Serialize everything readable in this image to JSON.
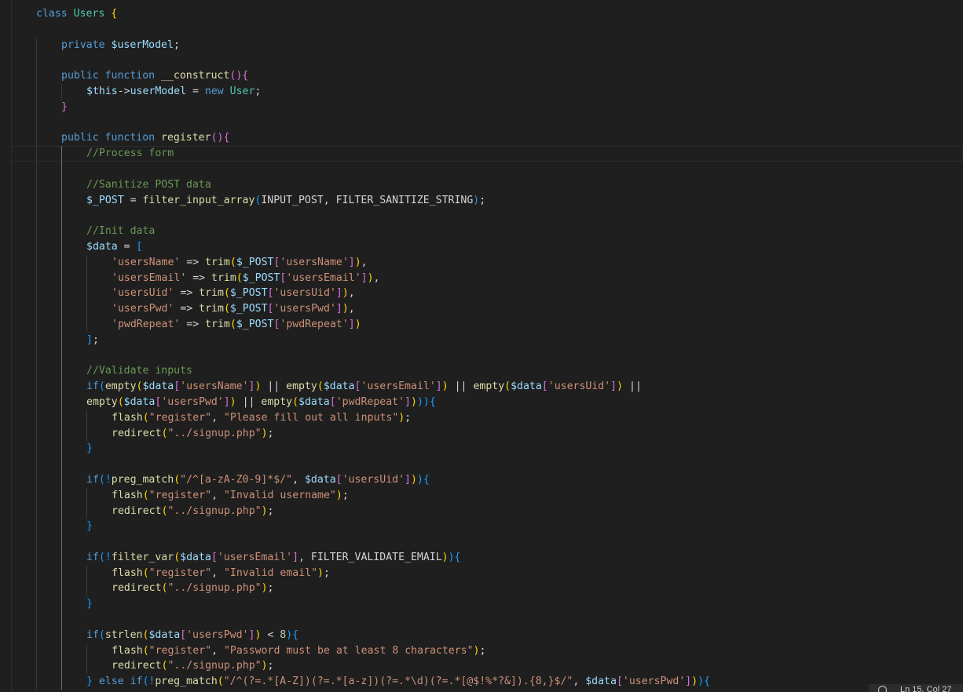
{
  "editor": {
    "language": "php",
    "lines": [
      [
        [
          "kw",
          "class "
        ],
        [
          "cls",
          "Users "
        ],
        [
          "b1",
          "{"
        ]
      ],
      [],
      [
        [
          "kw",
          "private "
        ],
        [
          "var",
          "$userModel"
        ],
        [
          "op",
          ";"
        ]
      ],
      [],
      [
        [
          "kw",
          "public "
        ],
        [
          "kw",
          "function "
        ],
        [
          "fn",
          "__construct"
        ],
        [
          "b2",
          "(){"
        ]
      ],
      [
        [
          "var",
          "$this"
        ],
        [
          "op",
          "->"
        ],
        [
          "var",
          "userModel"
        ],
        [
          "op",
          " = "
        ],
        [
          "kw",
          "new "
        ],
        [
          "cls",
          "User"
        ],
        [
          "op",
          ";"
        ]
      ],
      [
        [
          "b2",
          "}"
        ]
      ],
      [],
      [
        [
          "kw",
          "public "
        ],
        [
          "kw",
          "function "
        ],
        [
          "fn",
          "register"
        ],
        [
          "b2",
          "(){"
        ]
      ],
      [
        [
          "cmt",
          "//Process form"
        ]
      ],
      [],
      [
        [
          "cmt",
          "//Sanitize POST data"
        ]
      ],
      [
        [
          "var",
          "$_POST"
        ],
        [
          "op",
          " = "
        ],
        [
          "fn",
          "filter_input_array"
        ],
        [
          "b3",
          "("
        ],
        [
          "const",
          "INPUT_POST, FILTER_SANITIZE_STRING"
        ],
        [
          "b3",
          ")"
        ],
        [
          "op",
          ";"
        ]
      ],
      [],
      [
        [
          "cmt",
          "//Init data"
        ]
      ],
      [
        [
          "var",
          "$data"
        ],
        [
          "op",
          " = "
        ],
        [
          "b3",
          "["
        ]
      ],
      [
        [
          "str",
          "'usersName'"
        ],
        [
          "op",
          " => "
        ],
        [
          "fn",
          "trim"
        ],
        [
          "b1",
          "("
        ],
        [
          "var",
          "$_POST"
        ],
        [
          "b2",
          "["
        ],
        [
          "str",
          "'usersName'"
        ],
        [
          "b2",
          "]"
        ],
        [
          "b1",
          ")"
        ],
        [
          "op",
          ","
        ]
      ],
      [
        [
          "str",
          "'usersEmail'"
        ],
        [
          "op",
          " => "
        ],
        [
          "fn",
          "trim"
        ],
        [
          "b1",
          "("
        ],
        [
          "var",
          "$_POST"
        ],
        [
          "b2",
          "["
        ],
        [
          "str",
          "'usersEmail'"
        ],
        [
          "b2",
          "]"
        ],
        [
          "b1",
          ")"
        ],
        [
          "op",
          ","
        ]
      ],
      [
        [
          "str",
          "'usersUid'"
        ],
        [
          "op",
          " => "
        ],
        [
          "fn",
          "trim"
        ],
        [
          "b1",
          "("
        ],
        [
          "var",
          "$_POST"
        ],
        [
          "b2",
          "["
        ],
        [
          "str",
          "'usersUid'"
        ],
        [
          "b2",
          "]"
        ],
        [
          "b1",
          ")"
        ],
        [
          "op",
          ","
        ]
      ],
      [
        [
          "str",
          "'usersPwd'"
        ],
        [
          "op",
          " => "
        ],
        [
          "fn",
          "trim"
        ],
        [
          "b1",
          "("
        ],
        [
          "var",
          "$_POST"
        ],
        [
          "b2",
          "["
        ],
        [
          "str",
          "'usersPwd'"
        ],
        [
          "b2",
          "]"
        ],
        [
          "b1",
          ")"
        ],
        [
          "op",
          ","
        ]
      ],
      [
        [
          "str",
          "'pwdRepeat'"
        ],
        [
          "op",
          " => "
        ],
        [
          "fn",
          "trim"
        ],
        [
          "b1",
          "("
        ],
        [
          "var",
          "$_POST"
        ],
        [
          "b2",
          "["
        ],
        [
          "str",
          "'pwdRepeat'"
        ],
        [
          "b2",
          "]"
        ],
        [
          "b1",
          ")"
        ]
      ],
      [
        [
          "b3",
          "]"
        ],
        [
          "op",
          ";"
        ]
      ],
      [],
      [
        [
          "cmt",
          "//Validate inputs"
        ]
      ],
      [
        [
          "kw",
          "if"
        ],
        [
          "b3",
          "("
        ],
        [
          "fn",
          "empty"
        ],
        [
          "b1",
          "("
        ],
        [
          "var",
          "$data"
        ],
        [
          "b2",
          "["
        ],
        [
          "str",
          "'usersName'"
        ],
        [
          "b2",
          "]"
        ],
        [
          "b1",
          ")"
        ],
        [
          "op",
          " || "
        ],
        [
          "fn",
          "empty"
        ],
        [
          "b1",
          "("
        ],
        [
          "var",
          "$data"
        ],
        [
          "b2",
          "["
        ],
        [
          "str",
          "'usersEmail'"
        ],
        [
          "b2",
          "]"
        ],
        [
          "b1",
          ")"
        ],
        [
          "op",
          " || "
        ],
        [
          "fn",
          "empty"
        ],
        [
          "b1",
          "("
        ],
        [
          "var",
          "$data"
        ],
        [
          "b2",
          "["
        ],
        [
          "str",
          "'usersUid'"
        ],
        [
          "b2",
          "]"
        ],
        [
          "b1",
          ")"
        ],
        [
          "op",
          " ||"
        ]
      ],
      [
        [
          "fn",
          "empty"
        ],
        [
          "b1",
          "("
        ],
        [
          "var",
          "$data"
        ],
        [
          "b2",
          "["
        ],
        [
          "str",
          "'usersPwd'"
        ],
        [
          "b2",
          "]"
        ],
        [
          "b1",
          ")"
        ],
        [
          "op",
          " || "
        ],
        [
          "fn",
          "empty"
        ],
        [
          "b1",
          "("
        ],
        [
          "var",
          "$data"
        ],
        [
          "b2",
          "["
        ],
        [
          "str",
          "'pwdRepeat'"
        ],
        [
          "b2",
          "]"
        ],
        [
          "b1",
          ")"
        ],
        [
          "b3",
          ")){"
        ]
      ],
      [
        [
          "fn",
          "flash"
        ],
        [
          "b1",
          "("
        ],
        [
          "str",
          "\"register\""
        ],
        [
          "op",
          ", "
        ],
        [
          "str",
          "\"Please fill out all inputs\""
        ],
        [
          "b1",
          ")"
        ],
        [
          "op",
          ";"
        ]
      ],
      [
        [
          "fn",
          "redirect"
        ],
        [
          "b1",
          "("
        ],
        [
          "str",
          "\"../signup.php\""
        ],
        [
          "b1",
          ")"
        ],
        [
          "op",
          ";"
        ]
      ],
      [
        [
          "b3",
          "}"
        ]
      ],
      [],
      [
        [
          "kw",
          "if"
        ],
        [
          "b3",
          "(!"
        ],
        [
          "fn",
          "preg_match"
        ],
        [
          "b1",
          "("
        ],
        [
          "str",
          "\"/^[a-zA-Z0-9]*$/\""
        ],
        [
          "op",
          ", "
        ],
        [
          "var",
          "$data"
        ],
        [
          "b2",
          "["
        ],
        [
          "str",
          "'usersUid'"
        ],
        [
          "b2",
          "]"
        ],
        [
          "b1",
          ")"
        ],
        [
          "b3",
          "){"
        ]
      ],
      [
        [
          "fn",
          "flash"
        ],
        [
          "b1",
          "("
        ],
        [
          "str",
          "\"register\""
        ],
        [
          "op",
          ", "
        ],
        [
          "str",
          "\"Invalid username\""
        ],
        [
          "b1",
          ")"
        ],
        [
          "op",
          ";"
        ]
      ],
      [
        [
          "fn",
          "redirect"
        ],
        [
          "b1",
          "("
        ],
        [
          "str",
          "\"../signup.php\""
        ],
        [
          "b1",
          ")"
        ],
        [
          "op",
          ";"
        ]
      ],
      [
        [
          "b3",
          "}"
        ]
      ],
      [],
      [
        [
          "kw",
          "if"
        ],
        [
          "b3",
          "(!"
        ],
        [
          "fn",
          "filter_var"
        ],
        [
          "b1",
          "("
        ],
        [
          "var",
          "$data"
        ],
        [
          "b2",
          "["
        ],
        [
          "str",
          "'usersEmail'"
        ],
        [
          "b2",
          "]"
        ],
        [
          "op",
          ", "
        ],
        [
          "const",
          "FILTER_VALIDATE_EMAIL"
        ],
        [
          "b1",
          ")"
        ],
        [
          "b3",
          "){"
        ]
      ],
      [
        [
          "fn",
          "flash"
        ],
        [
          "b1",
          "("
        ],
        [
          "str",
          "\"register\""
        ],
        [
          "op",
          ", "
        ],
        [
          "str",
          "\"Invalid email\""
        ],
        [
          "b1",
          ")"
        ],
        [
          "op",
          ";"
        ]
      ],
      [
        [
          "fn",
          "redirect"
        ],
        [
          "b1",
          "("
        ],
        [
          "str",
          "\"../signup.php\""
        ],
        [
          "b1",
          ")"
        ],
        [
          "op",
          ";"
        ]
      ],
      [
        [
          "b3",
          "}"
        ]
      ],
      [],
      [
        [
          "kw",
          "if"
        ],
        [
          "b3",
          "("
        ],
        [
          "fn",
          "strlen"
        ],
        [
          "b1",
          "("
        ],
        [
          "var",
          "$data"
        ],
        [
          "b2",
          "["
        ],
        [
          "str",
          "'usersPwd'"
        ],
        [
          "b2",
          "]"
        ],
        [
          "b1",
          ")"
        ],
        [
          "op",
          " < "
        ],
        [
          "num",
          "8"
        ],
        [
          "b3",
          "){"
        ]
      ],
      [
        [
          "fn",
          "flash"
        ],
        [
          "b1",
          "("
        ],
        [
          "str",
          "\"register\""
        ],
        [
          "op",
          ", "
        ],
        [
          "str",
          "\"Password must be at least 8 characters\""
        ],
        [
          "b1",
          ")"
        ],
        [
          "op",
          ";"
        ]
      ],
      [
        [
          "fn",
          "redirect"
        ],
        [
          "b1",
          "("
        ],
        [
          "str",
          "\"../signup.php\""
        ],
        [
          "b1",
          ")"
        ],
        [
          "op",
          ";"
        ]
      ],
      [
        [
          "b3",
          "} "
        ],
        [
          "kw",
          "else if"
        ],
        [
          "b3",
          "(!"
        ],
        [
          "fn",
          "preg_match"
        ],
        [
          "b1",
          "("
        ],
        [
          "str",
          "\"/^(?=.*[A-Z])(?=.*[a-z])(?=.*\\d)(?=.*[@$!%*?&]).{8,}$/\""
        ],
        [
          "op",
          ", "
        ],
        [
          "var",
          "$data"
        ],
        [
          "b2",
          "["
        ],
        [
          "str",
          "'usersPwd'"
        ],
        [
          "b2",
          "]"
        ],
        [
          "b1",
          ")"
        ],
        [
          "b3",
          "){"
        ]
      ]
    ]
  },
  "status_bar": {
    "cursor_position": "Ln 15, Col 27"
  }
}
